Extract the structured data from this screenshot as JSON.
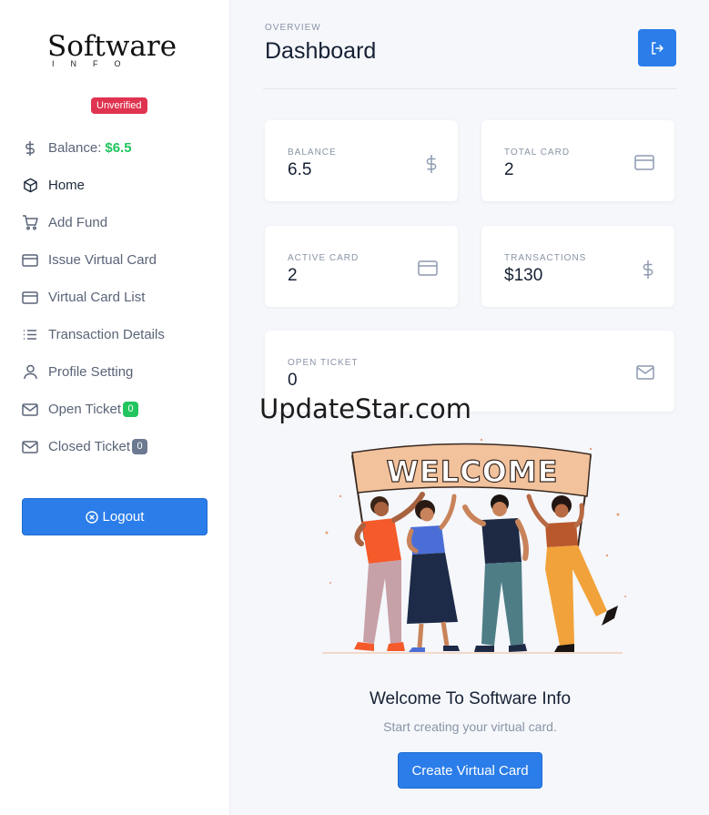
{
  "brand": {
    "word": "Software",
    "sub": "INFO"
  },
  "status": {
    "badge": "Unverified"
  },
  "sidebar": {
    "items": [
      {
        "label": "Balance:",
        "amount": "$6.5",
        "icon": "dollar-icon"
      },
      {
        "label": "Home",
        "icon": "cube-icon"
      },
      {
        "label": "Add Fund",
        "icon": "cart-icon"
      },
      {
        "label": "Issue Virtual Card",
        "icon": "card-icon"
      },
      {
        "label": "Virtual Card List",
        "icon": "card-icon"
      },
      {
        "label": "Transaction Details",
        "icon": "list-icon"
      },
      {
        "label": "Profile Setting",
        "icon": "user-icon"
      },
      {
        "label": "Open Ticket",
        "count": "0",
        "icon": "mail-icon"
      },
      {
        "label": "Closed Ticket",
        "count": "0",
        "icon": "mail-icon"
      }
    ],
    "logout_label": "Logout"
  },
  "header": {
    "eyebrow": "OVERVIEW",
    "title": "Dashboard"
  },
  "stats": [
    {
      "label": "BALANCE",
      "value": "6.5",
      "icon": "dollar-icon"
    },
    {
      "label": "TOTAL CARD",
      "value": "2",
      "icon": "card-icon"
    },
    {
      "label": "ACTIVE CARD",
      "value": "2",
      "icon": "card-icon"
    },
    {
      "label": "TRANSACTIONS",
      "value": "$130",
      "icon": "dollar-icon"
    },
    {
      "label": "OPEN TICKET",
      "value": "0",
      "icon": "mail-icon"
    }
  ],
  "watermark": "UpdateStar.com",
  "welcome": {
    "banner": "WELCOME",
    "title": "Welcome To Software Info",
    "subtitle": "Start creating your virtual card.",
    "cta": "Create Virtual Card"
  },
  "colors": {
    "accent": "#2b7de9",
    "success": "#22c55e",
    "danger": "#e0334f"
  }
}
